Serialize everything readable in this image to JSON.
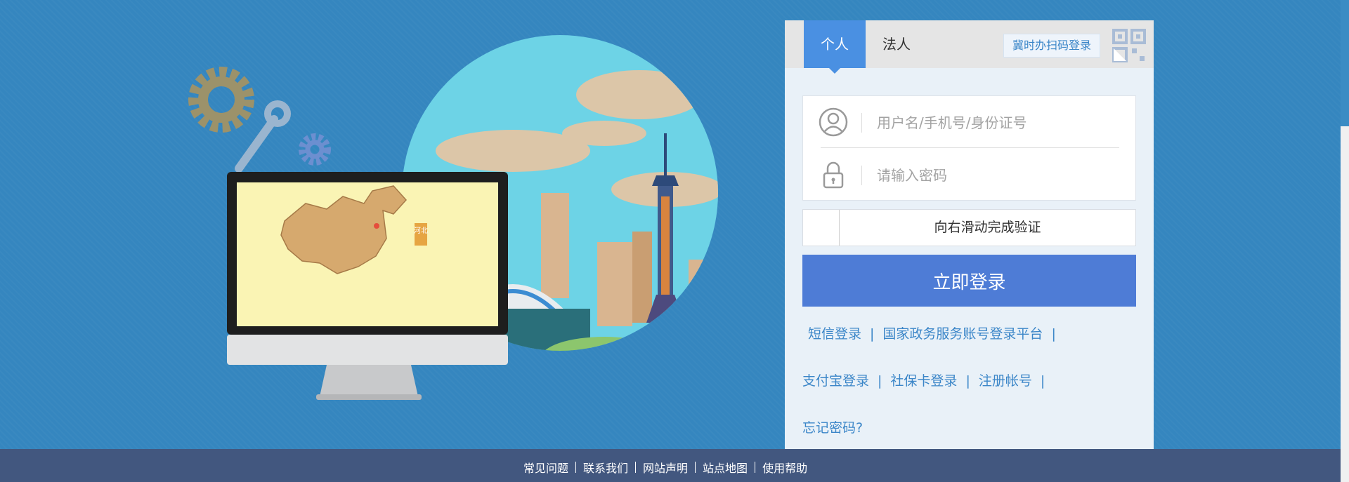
{
  "tabs": {
    "personal": "个人",
    "corporate": "法人"
  },
  "qr_login_hint": "冀时办扫码登录",
  "fields": {
    "username_placeholder": "用户名/手机号/身份证号",
    "password_placeholder": "请输入密码"
  },
  "slider": {
    "label": "向右滑动完成验证"
  },
  "login_button": "立即登录",
  "links": {
    "sms_login": "短信登录",
    "national_platform": "国家政务服务账号登录平台",
    "alipay_login": "支付宝登录",
    "social_card_login": "社保卡登录",
    "register": "注册帐号",
    "forgot_password": "忘记密码?",
    "separator": "|"
  },
  "illustration": {
    "map_label": "河北"
  },
  "footer": {
    "faq": "常见问题",
    "contact": "联系我们",
    "statement": "网站声明",
    "sitemap": "站点地图",
    "help": "使用帮助"
  },
  "colors": {
    "background": "#3586bf",
    "accent_tab": "#4a90e2",
    "login_button": "#4e7cd6",
    "link": "#3b86c8",
    "footer": "#42577f"
  }
}
